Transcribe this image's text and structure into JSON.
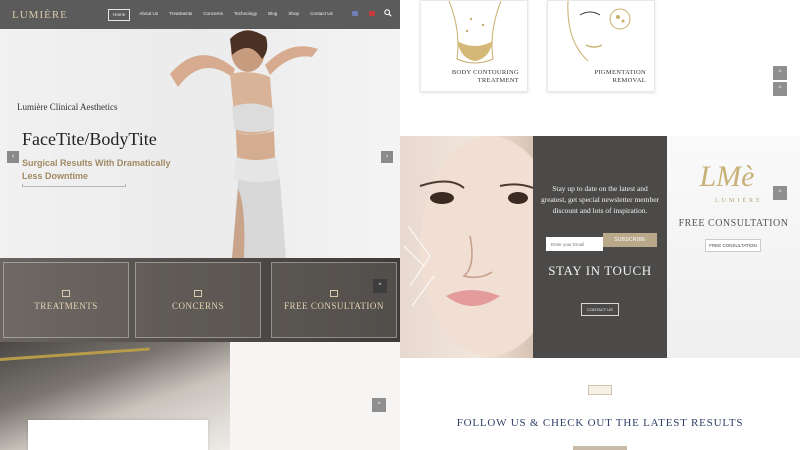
{
  "brand": {
    "logo": "LUMIÈRE"
  },
  "nav": {
    "items": [
      "Home",
      "About Us",
      "Treatments",
      "Concerns",
      "Technology",
      "Blog",
      "Shop",
      "Contact Us"
    ],
    "active_index": 0
  },
  "hero": {
    "title": "FaceTite/BodyTite",
    "subtitle": "Surgical Results With Dramatically Less Downtime",
    "prev_label": "‹",
    "next_label": "›"
  },
  "cards": [
    {
      "label": "TREATMENTS"
    },
    {
      "label": "CONCERNS"
    },
    {
      "label": "FREE CONSULTATION"
    }
  ],
  "bottom_left": {
    "card_text": "Lumière Clinical Aesthetics"
  },
  "treatments": [
    {
      "label_line1": "BODY CONTOURING",
      "label_line2": "TREATMENT"
    },
    {
      "label_line1": "PIGMENTATION",
      "label_line2": "REMOVAL"
    }
  ],
  "newsletter": {
    "text": "Stay up to date on the latest and greatest, get special newsletter member discount and lots of inspiration.",
    "input_placeholder": "Enter your Email",
    "subscribe_label": "SUBSCRIBE",
    "title": "STAY IN TOUCH",
    "contact_label": "CONTACT US"
  },
  "consult": {
    "logo_text": "LMè",
    "logo_sub": "LUMIÈRE",
    "title": "FREE CONSULTATION",
    "button_label": "FREE CONSULTATION"
  },
  "follow": {
    "title": "FOLLOW US & CHECK OUT THE LATEST RESULTS"
  },
  "icons": {
    "search": "search-icon",
    "up_arrow": "^"
  },
  "colors": {
    "nav_bg": "#5b5b5b",
    "gold": "#a08a63",
    "dark_panel": "#4b4a49",
    "navy_text": "#2f3f66"
  }
}
